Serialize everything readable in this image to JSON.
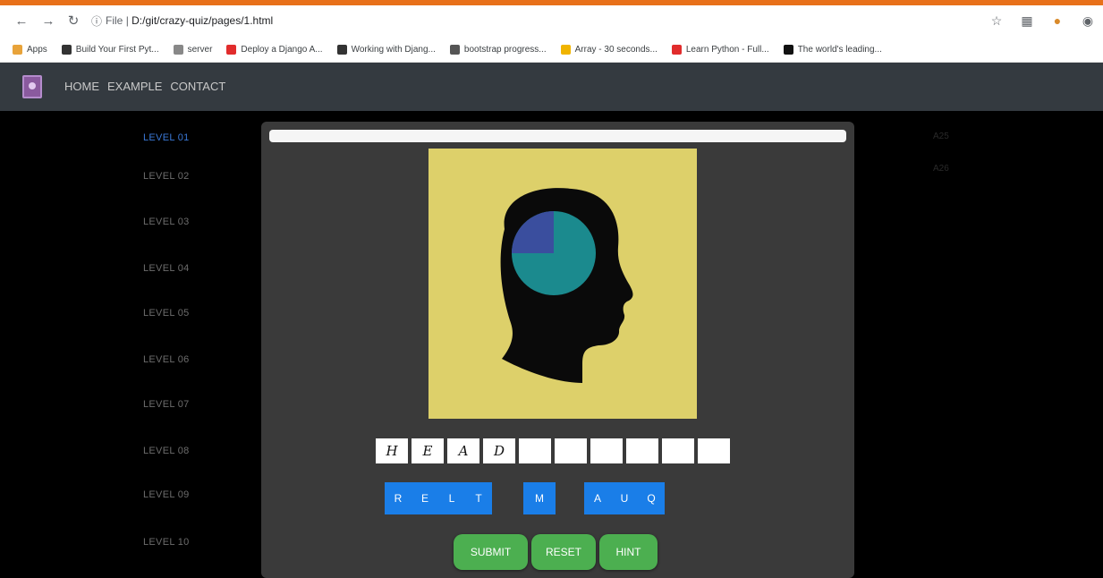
{
  "browser": {
    "url_prefix": "File",
    "url_path": "D:/git/crazy-quiz/pages/1.html",
    "bookmarks": [
      {
        "label": "Apps",
        "color": "#e8a33a"
      },
      {
        "label": "Build Your First Pyt...",
        "color": "#333"
      },
      {
        "label": "server",
        "color": "#888"
      },
      {
        "label": "Deploy a Django A...",
        "color": "#e12c2c"
      },
      {
        "label": "Working with Djang...",
        "color": "#333"
      },
      {
        "label": "bootstrap progress...",
        "color": "#555"
      },
      {
        "label": "Array - 30 seconds...",
        "color": "#f0b400"
      },
      {
        "label": "Learn Python - Full...",
        "color": "#e12c2c"
      },
      {
        "label": "The world's leading...",
        "color": "#111"
      }
    ]
  },
  "navbar": {
    "links": [
      "HOME",
      "EXAMPLE",
      "CONTACT"
    ]
  },
  "levels": [
    "LEVEL 01",
    "LEVEL 02",
    "LEVEL 03",
    "LEVEL 04",
    "LEVEL 05",
    "LEVEL 06",
    "LEVEL 07",
    "LEVEL 08",
    "LEVEL 09",
    "LEVEL 10"
  ],
  "active_level": 0,
  "right_side": [
    "A25",
    "A26"
  ],
  "quiz": {
    "progress": 1.0,
    "answer_slots": [
      "H",
      "E",
      "A",
      "D",
      "",
      "",
      "",
      "",
      "",
      ""
    ],
    "letter_groups": [
      [
        "R",
        "E",
        "L",
        "T"
      ],
      [
        "M"
      ],
      [
        "A",
        "U",
        "Q"
      ]
    ],
    "buttons": {
      "submit": "SUBMIT",
      "reset": "RESET",
      "hint": "HINT"
    }
  },
  "colors": {
    "accent": "#e8701a",
    "navbar": "#343a40",
    "letter_button": "#1a7ee8",
    "action_button": "#4caf50",
    "puzzle_bg": "#ddd06a",
    "brain": "#1b8a8e",
    "brain_slice": "#3a4e9e"
  }
}
